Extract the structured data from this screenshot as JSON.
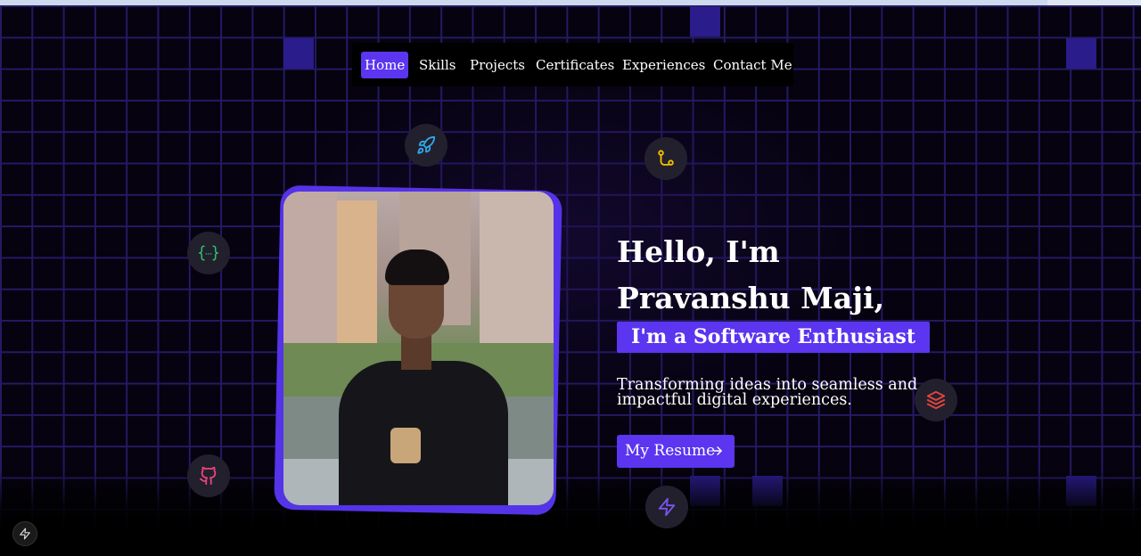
{
  "nav": {
    "items": [
      {
        "label": "Home",
        "active": true
      },
      {
        "label": "Skills"
      },
      {
        "label": "Projects"
      },
      {
        "label": "Certificates"
      },
      {
        "label": "Experiences"
      },
      {
        "label": "Contact Me"
      }
    ]
  },
  "hero": {
    "greeting": "Hello, I'm",
    "name": "Pravanshu Maji,",
    "tagline": "I'm a Software Enthusiast",
    "description": "Transforming ideas into seamless and impactful digital experiences.",
    "resume_label": "My Resume"
  },
  "floating_icons": [
    "rocket-icon",
    "git-branch-icon",
    "code-braces-icon",
    "layers-icon",
    "github-icon",
    "lightning-icon"
  ],
  "colors": {
    "accent": "#5b35f0",
    "grid_line": "#241a64",
    "background": "#06020f",
    "rocket": "#2fa7e8",
    "git": "#f2c200",
    "code": "#2fbf6a",
    "layers": "#e8453c",
    "github": "#e8457a",
    "lightning": "#7a55f0"
  }
}
